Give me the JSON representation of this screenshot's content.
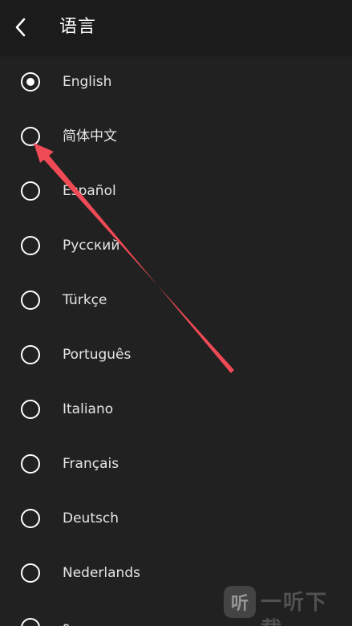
{
  "header": {
    "title": "语言",
    "back_icon": "chevron-left-icon"
  },
  "languages": [
    {
      "label": "English",
      "selected": true
    },
    {
      "label": "简体中文",
      "selected": false
    },
    {
      "label": "Español",
      "selected": false
    },
    {
      "label": "Русский",
      "selected": false
    },
    {
      "label": "Türkçe",
      "selected": false
    },
    {
      "label": "Português",
      "selected": false
    },
    {
      "label": "Italiano",
      "selected": false
    },
    {
      "label": "Français",
      "selected": false
    },
    {
      "label": "Deutsch",
      "selected": false
    },
    {
      "label": "Nederlands",
      "selected": false
    },
    {
      "label": "ๆ",
      "selected": false
    }
  ],
  "annotation": {
    "color": "#ef4a55",
    "points_to": "简体中文"
  },
  "watermark": {
    "logo_text": "听",
    "text": "一听下载"
  },
  "colors": {
    "background": "#212121",
    "header_background": "#1b1b1b",
    "text": "#e6e6e6",
    "radio": "#ffffff"
  }
}
